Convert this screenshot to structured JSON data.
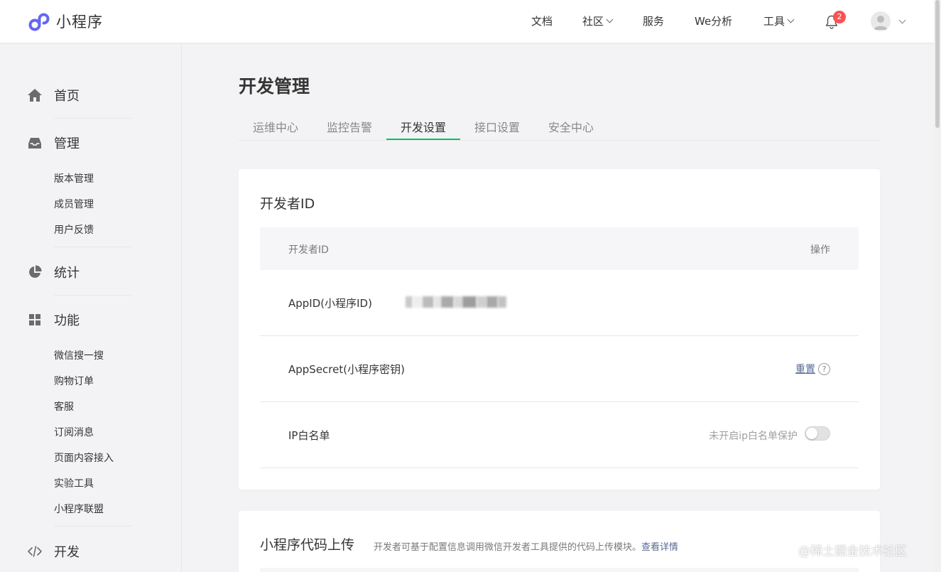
{
  "header": {
    "app_title": "小程序",
    "nav": {
      "docs": "文档",
      "community": "社区",
      "service": "服务",
      "analytics": "We分析",
      "tools": "工具"
    },
    "notification_count": "2"
  },
  "sidebar": {
    "home": "首页",
    "manage": "管理",
    "manage_items": [
      "版本管理",
      "成员管理",
      "用户反馈"
    ],
    "stats": "统计",
    "features": "功能",
    "feature_items": [
      "微信搜一搜",
      "购物订单",
      "客服",
      "订阅消息",
      "页面内容接入",
      "实验工具",
      "小程序联盟"
    ],
    "develop": "开发"
  },
  "main": {
    "title": "开发管理",
    "tabs": [
      "运维中心",
      "监控告警",
      "开发设置",
      "接口设置",
      "安全中心"
    ],
    "active_tab": "开发设置",
    "dev_id_card": {
      "title": "开发者ID",
      "col_id": "开发者ID",
      "col_action": "操作",
      "appid_label": "AppID(小程序ID)",
      "appsecret_label": "AppSecret(小程序密钥)",
      "reset_link": "重置",
      "help_mark": "?",
      "ip_label": "IP白名单",
      "ip_hint": "未开启ip白名单保护",
      "ip_whitelist_enabled": false
    },
    "upload_card": {
      "title": "小程序代码上传",
      "description": "开发者可基于配置信息调用微信开发者工具提供的代码上传模块。",
      "details_link": "查看详情"
    }
  },
  "watermark": "@稀土掘金技术社区",
  "colors": {
    "accent_green": "#07c160",
    "link_blue": "#576b95",
    "logo_purple": "#6467f0",
    "badge_red": "#fa5151"
  }
}
